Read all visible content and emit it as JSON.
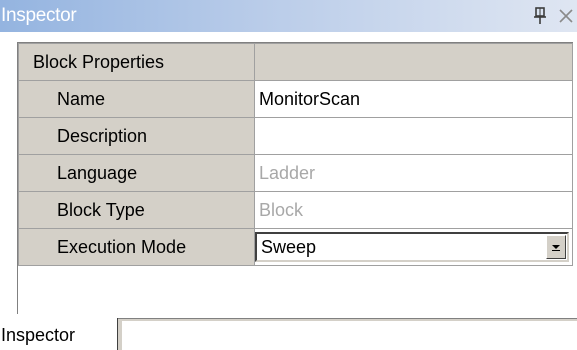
{
  "window": {
    "title": "Inspector"
  },
  "titlebar_icons": {
    "pin": "pin-icon",
    "close": "close-icon"
  },
  "properties": {
    "category": {
      "label": "Block Properties",
      "value": ""
    },
    "rows": [
      {
        "label": "Name",
        "value": "MonitorScan",
        "readonly": false
      },
      {
        "label": "Description",
        "value": "",
        "readonly": false
      },
      {
        "label": "Language",
        "value": "Ladder",
        "readonly": true
      },
      {
        "label": "Block Type",
        "value": "Block",
        "readonly": true
      },
      {
        "label": "Execution Mode",
        "value": "Sweep",
        "readonly": false,
        "control": "dropdown"
      }
    ]
  },
  "tabs": [
    {
      "label": "Inspector",
      "selected": true
    }
  ],
  "colors": {
    "title_gradient_start": "#94b4e0",
    "title_gradient_end": "#dfe6f2",
    "label_background": "#d4d0c8",
    "readonly_text": "#a8a8a8"
  }
}
